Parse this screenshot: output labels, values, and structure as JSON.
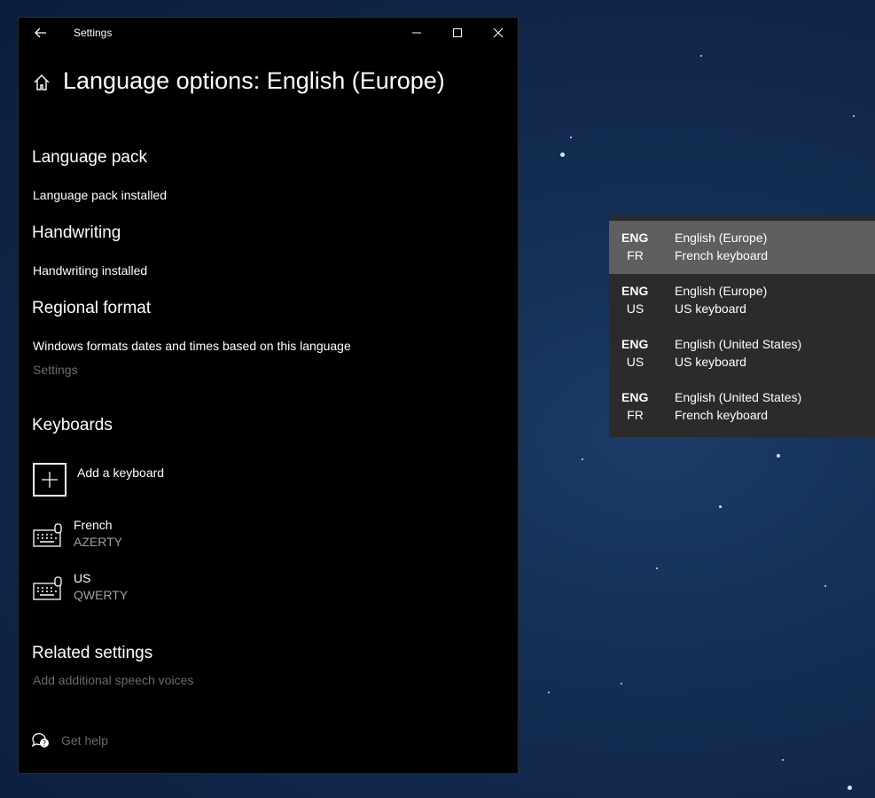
{
  "window": {
    "title": "Settings",
    "page_title": "Language options: English (Europe)"
  },
  "sections": {
    "language_pack": {
      "heading": "Language pack",
      "status": "Language pack installed"
    },
    "handwriting": {
      "heading": "Handwriting",
      "status": "Handwriting installed"
    },
    "regional_format": {
      "heading": "Regional format",
      "description": "Windows formats dates and times based on this language",
      "settings_link": "Settings"
    },
    "keyboards": {
      "heading": "Keyboards",
      "add_label": "Add a keyboard",
      "items": [
        {
          "name": "French",
          "layout": "AZERTY"
        },
        {
          "name": "US",
          "layout": "QWERTY"
        }
      ]
    },
    "related": {
      "heading": "Related settings",
      "link": "Add additional speech voices"
    }
  },
  "help": {
    "label": "Get help"
  },
  "flyout": {
    "items": [
      {
        "lang": "ENG",
        "region": "FR",
        "name": "English (Europe)",
        "keyboard": "French keyboard",
        "selected": true
      },
      {
        "lang": "ENG",
        "region": "US",
        "name": "English (Europe)",
        "keyboard": "US keyboard",
        "selected": false
      },
      {
        "lang": "ENG",
        "region": "US",
        "name": "English (United States)",
        "keyboard": "US keyboard",
        "selected": false
      },
      {
        "lang": "ENG",
        "region": "FR",
        "name": "English (United States)",
        "keyboard": "French keyboard",
        "selected": false
      }
    ]
  }
}
